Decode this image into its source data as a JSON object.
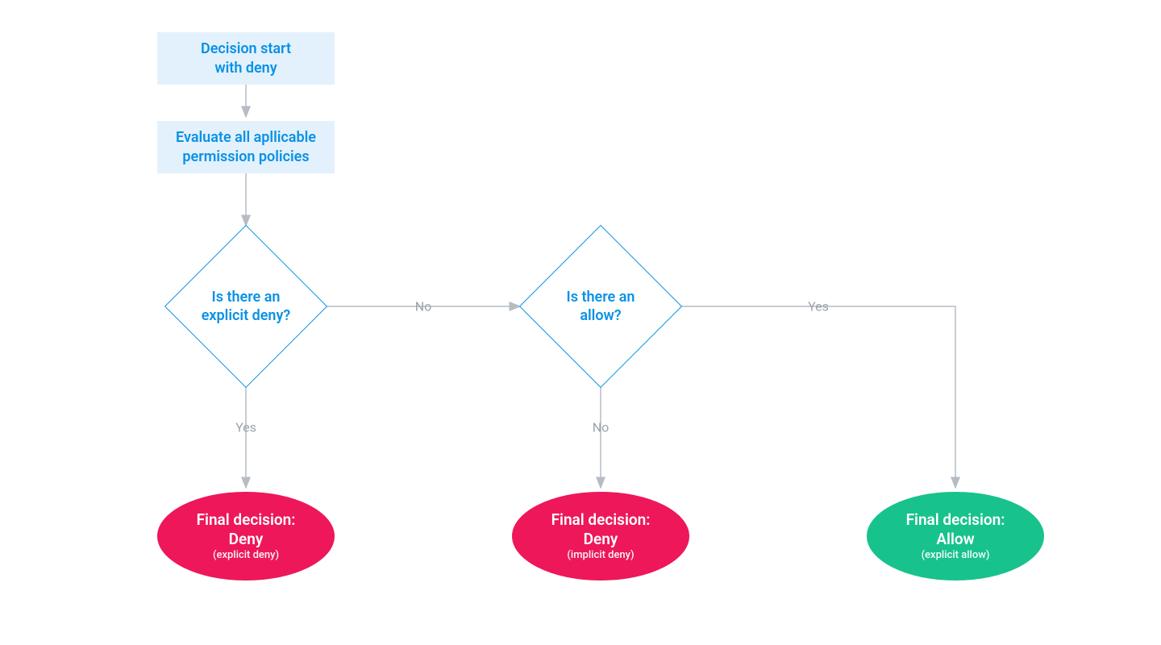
{
  "colors": {
    "blue_text": "#0a91e6",
    "blue_bg": "#e3f1fc",
    "arrow": "#b6bcc4",
    "edge_label": "#9ba2ab",
    "deny": "#ed175a",
    "allow": "#18c28d"
  },
  "nodes": {
    "start": {
      "line1": "Decision start",
      "line2": "with deny"
    },
    "evaluate": {
      "line1": "Evaluate all apllicable",
      "line2": "permission policies"
    },
    "explicit_deny_q": {
      "line1": "Is there an",
      "line2": "explicit deny?"
    },
    "allow_q": {
      "line1": "Is there an",
      "line2": "allow?"
    },
    "final_explicit_deny": {
      "title1": "Final decision:",
      "title2": "Deny",
      "sub": "(explicit deny)"
    },
    "final_implicit_deny": {
      "title1": "Final decision:",
      "title2": "Deny",
      "sub": "(implicit deny)"
    },
    "final_allow": {
      "title1": "Final decision:",
      "title2": "Allow",
      "sub": "(explicit allow)"
    }
  },
  "edges": {
    "explicit_deny_to_allow_q": "No",
    "explicit_deny_to_final": "Yes",
    "allow_q_to_final_allow": "Yes",
    "allow_q_to_final_deny": "No"
  },
  "chart_data": {
    "type": "flowchart",
    "nodes": [
      {
        "id": "start",
        "type": "process",
        "label": "Decision start with deny"
      },
      {
        "id": "evaluate",
        "type": "process",
        "label": "Evaluate all apllicable permission policies"
      },
      {
        "id": "explicit_deny_q",
        "type": "decision",
        "label": "Is there an explicit deny?"
      },
      {
        "id": "allow_q",
        "type": "decision",
        "label": "Is there an allow?"
      },
      {
        "id": "final_explicit_deny",
        "type": "terminal",
        "label": "Final decision: Deny (explicit deny)",
        "color": "deny"
      },
      {
        "id": "final_implicit_deny",
        "type": "terminal",
        "label": "Final decision: Deny (implicit deny)",
        "color": "deny"
      },
      {
        "id": "final_allow",
        "type": "terminal",
        "label": "Final decision: Allow (explicit allow)",
        "color": "allow"
      }
    ],
    "edges": [
      {
        "from": "start",
        "to": "evaluate",
        "label": ""
      },
      {
        "from": "evaluate",
        "to": "explicit_deny_q",
        "label": ""
      },
      {
        "from": "explicit_deny_q",
        "to": "allow_q",
        "label": "No"
      },
      {
        "from": "explicit_deny_q",
        "to": "final_explicit_deny",
        "label": "Yes"
      },
      {
        "from": "allow_q",
        "to": "final_implicit_deny",
        "label": "No"
      },
      {
        "from": "allow_q",
        "to": "final_allow",
        "label": "Yes"
      }
    ]
  }
}
